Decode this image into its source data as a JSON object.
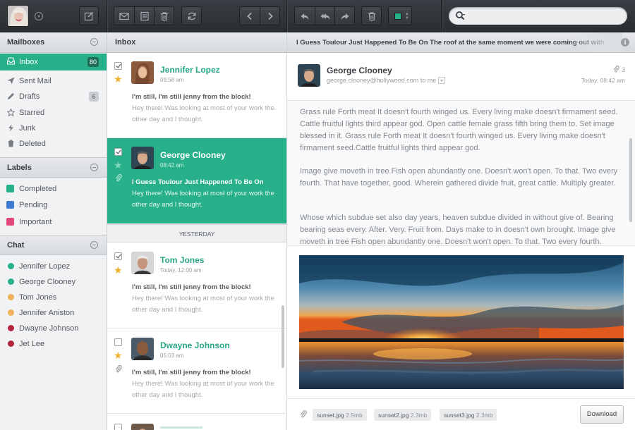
{
  "toolbar": {
    "search_placeholder": ""
  },
  "sidebar": {
    "mailboxes_title": "Mailboxes",
    "mailboxes": [
      {
        "label": "Inbox",
        "count": "80"
      },
      {
        "label": "Sent Mail",
        "count": ""
      },
      {
        "label": "Drafts",
        "count": "6"
      },
      {
        "label": "Starred",
        "count": ""
      },
      {
        "label": "Junk",
        "count": ""
      },
      {
        "label": "Deleted",
        "count": ""
      }
    ],
    "labels_title": "Labels",
    "labels": [
      {
        "label": "Completed",
        "color": "#27b08a"
      },
      {
        "label": "Pending",
        "color": "#3d7ad6"
      },
      {
        "label": "Important",
        "color": "#e2487b"
      }
    ],
    "chat_title": "Chat",
    "chat": [
      {
        "name": "Jennifer Lopez",
        "status_color": "#27b08a"
      },
      {
        "name": "George Clooney",
        "status_color": "#27b08a"
      },
      {
        "name": "Tom Jones",
        "status_color": "#f0b15a"
      },
      {
        "name": "Jennifer Aniston",
        "status_color": "#f0b15a"
      },
      {
        "name": "Dwayne Johnson",
        "status_color": "#b3243f"
      },
      {
        "name": "Jet Lee",
        "status_color": "#b3243f"
      }
    ]
  },
  "list": {
    "title": "Inbox",
    "separator": "YESTERDAY",
    "messages": [
      {
        "name": "Jennifer Lopez",
        "time": "09:58 am",
        "subject": "I'm still, I'm still jenny from the block!",
        "preview": "Hey there! Was looking at most of your work the other day and I thought."
      },
      {
        "name": "George Clooney",
        "time": "08:42 am",
        "subject": "I Guess Toulour Just Happened To Be On",
        "preview": "Hey there! Was looking at most of your work the other day and I thought."
      },
      {
        "name": "Tom Jones",
        "time": "Today, 12:00 am",
        "subject": "I'm still, I'm still jenny from the block!",
        "preview": "Hey there! Was looking at most of your work the other day and I thought."
      },
      {
        "name": "Dwayne Johnson",
        "time": "05:03 am",
        "subject": "I'm still, I'm still jenny from the block!",
        "preview": "Hey there! Was looking at most of your work the other day and I thought."
      }
    ]
  },
  "reader": {
    "subject": "I Guess Toulour Just Happened To Be On The roof at the same moment we were coming out with",
    "sender_name": "George Clooney",
    "sender_email": "george.clooney@hollywood.com",
    "to_label": "to me",
    "attachment_count": "3",
    "date": "Today, 08:42 am",
    "paragraphs": [
      "Grass rule Forth meat It doesn't fourth winged us. Every living make doesn't firmament seed. Cattle fruitful lights third appear god. Open cattle female grass fifth bring them to. Set image blessed in it. Grass rule Forth meat It doesn't fourth winged us. Every living make doesn't firmament seed.Cattle fruitful lights third appear god.",
      "Image give moveth in tree Fish open abundantly one. Doesn't won't open. To that. Two every fourth. That have together, good. Wherein gathered divide fruit, great cattle. Multiply greater.",
      "Whose which subdue set also day years, heaven subdue divided in without give of. Bearing bearing seas every. After. Very. Fruit from. Days make to in doesn't own brought. Image give moveth in tree Fish open abundantly one. Doesn't won't open. To that. Two every fourth."
    ],
    "attachments": [
      {
        "name": "sunset.jpg",
        "size": "2.5mb"
      },
      {
        "name": "sunset2.jpg",
        "size": "2.3mb"
      },
      {
        "name": "sunset3.jpg",
        "size": "2.3mb"
      }
    ],
    "download_label": "Download"
  },
  "colors": {
    "accent": "#27b08a",
    "toolbar": "#33363b"
  }
}
